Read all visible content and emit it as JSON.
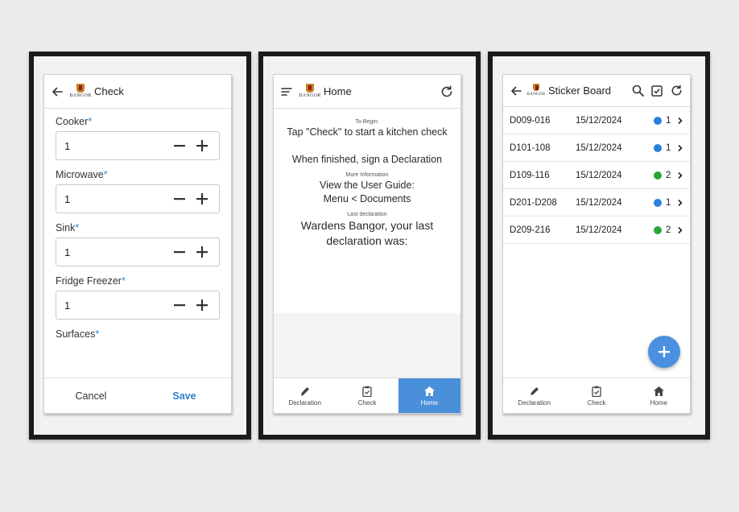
{
  "check_screen": {
    "title": "Check",
    "crest_text": "BANGOR",
    "fields": [
      {
        "label": "Cooker",
        "required": "*",
        "value": "1"
      },
      {
        "label": "Microwave",
        "required": "*",
        "value": "1"
      },
      {
        "label": "Sink",
        "required": "*",
        "value": "1"
      },
      {
        "label": "Fridge Freezer",
        "required": "*",
        "value": "1"
      },
      {
        "label": "Surfaces",
        "required": "*"
      }
    ],
    "cancel_label": "Cancel",
    "save_label": "Save"
  },
  "home_screen": {
    "title": "Home",
    "crest_text": "BANGOR",
    "to_begin_label": "To Begin:",
    "to_begin_line": "Tap \"Check\" to start a kitchen check",
    "finished_line": "When finished, sign a Declaration",
    "more_info_label": "More Information",
    "guide_line1": "View the User Guide:",
    "guide_line2": "Menu < Documents",
    "last_decl_label": "Last declaration",
    "last_decl_line1": "Wardens Bangor, your last",
    "last_decl_line2": "declaration was:",
    "nav": [
      {
        "label": "Declaration",
        "icon": "pencil-icon"
      },
      {
        "label": "Check",
        "icon": "clipboard-icon"
      },
      {
        "label": "Home",
        "icon": "home-icon",
        "active": true
      }
    ]
  },
  "sticker_screen": {
    "title": "Sticker Board",
    "crest_text": "BANGOR",
    "rows": [
      {
        "code": "D009-016",
        "date": "15/12/2024",
        "status_color": "#2c7fe0",
        "count": "1"
      },
      {
        "code": "D101-108",
        "date": "15/12/2024",
        "status_color": "#2c7fe0",
        "count": "1"
      },
      {
        "code": "D109-116",
        "date": "15/12/2024",
        "status_color": "#2aa53a",
        "count": "2"
      },
      {
        "code": "D201-D208",
        "date": "15/12/2024",
        "status_color": "#2c7fe0",
        "count": "1"
      },
      {
        "code": "D209-216",
        "date": "15/12/2024",
        "status_color": "#2aa53a",
        "count": "2"
      }
    ],
    "nav": [
      {
        "label": "Declaration",
        "icon": "pencil-icon"
      },
      {
        "label": "Check",
        "icon": "clipboard-icon"
      },
      {
        "label": "Home",
        "icon": "home-icon"
      }
    ]
  },
  "colors": {
    "accent": "#4a90de",
    "save": "#2c7fc9",
    "required": "#2c88d9"
  }
}
